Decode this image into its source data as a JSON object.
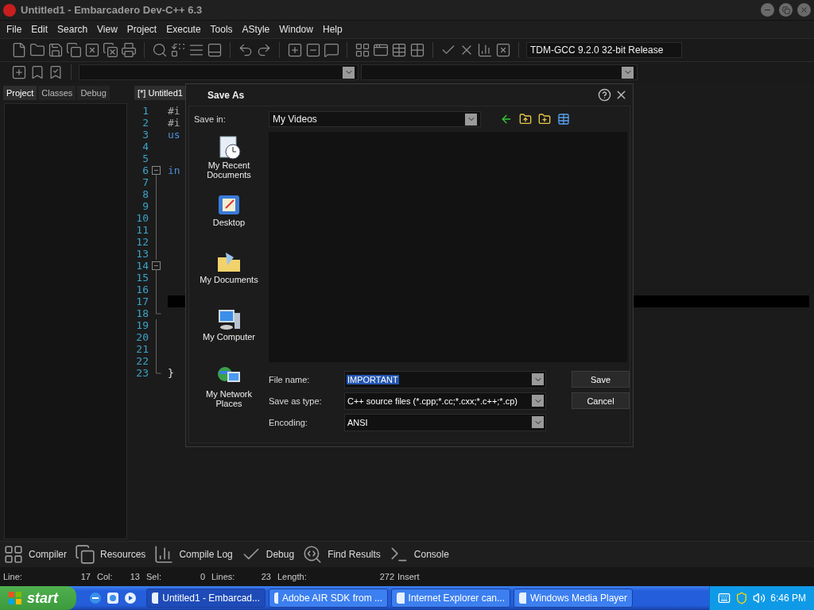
{
  "window": {
    "title": "Untitled1 - Embarcadero Dev-C++ 6.3"
  },
  "menu": [
    "File",
    "Edit",
    "Search",
    "View",
    "Project",
    "Execute",
    "Tools",
    "AStyle",
    "Window",
    "Help"
  ],
  "toolbar": {
    "compiler": "TDM-GCC 9.2.0 32-bit Release"
  },
  "left_panel": {
    "tabs": [
      {
        "label": "Project",
        "selected": true
      },
      {
        "label": "Classes",
        "selected": false
      },
      {
        "label": "Debug",
        "selected": false
      }
    ]
  },
  "editor": {
    "tabs": [
      {
        "label": "[*] Untitled1",
        "selected": true
      }
    ],
    "lines": [
      {
        "number": "1",
        "code": "#i",
        "kind": "directive",
        "current": false
      },
      {
        "number": "2",
        "code": "#i",
        "kind": "directive",
        "current": false
      },
      {
        "number": "3",
        "code": "us",
        "kind": "keyword",
        "current": false
      },
      {
        "number": "4",
        "current": false
      },
      {
        "number": "5",
        "current": false
      },
      {
        "number": "6",
        "code": "in",
        "kind": "keyword",
        "fold": {
          "kind": "open"
        },
        "current": false
      },
      {
        "number": "7",
        "fold": {
          "kind": "line"
        },
        "current": false
      },
      {
        "number": "8",
        "fold": {
          "kind": "line"
        },
        "current": false
      },
      {
        "number": "9",
        "fold": {
          "kind": "line"
        },
        "current": false
      },
      {
        "number": "10",
        "fold": {
          "kind": "line"
        },
        "current": false
      },
      {
        "number": "11",
        "fold": {
          "kind": "line"
        },
        "current": false
      },
      {
        "number": "12",
        "fold": {
          "kind": "line"
        },
        "current": false
      },
      {
        "number": "13",
        "fold": {
          "kind": "line"
        },
        "current": false
      },
      {
        "number": "14",
        "fold": {
          "kind": "open"
        },
        "current": false
      },
      {
        "number": "15",
        "fold": {
          "kind": "line"
        },
        "current": false
      },
      {
        "number": "16",
        "fold": {
          "kind": "line"
        },
        "current": false
      },
      {
        "number": "17",
        "fold": {
          "kind": "line"
        },
        "current": true
      },
      {
        "number": "18",
        "fold": {
          "kind": "end"
        },
        "current": false
      },
      {
        "number": "19",
        "fold": {
          "kind": "line"
        },
        "current": false
      },
      {
        "number": "20",
        "fold": {
          "kind": "line"
        },
        "current": false
      },
      {
        "number": "21",
        "fold": {
          "kind": "line"
        },
        "current": false
      },
      {
        "number": "22",
        "fold": {
          "kind": "line"
        },
        "current": false
      },
      {
        "number": "23",
        "code": "}",
        "kind": "brace",
        "fold": {
          "kind": "end"
        },
        "current": false
      }
    ]
  },
  "dialog": {
    "title": "Save As",
    "save_in": {
      "label": "Save in:",
      "value": "My Videos"
    },
    "places": [
      "My Recent Documents",
      "Desktop",
      "My Documents",
      "My Computer",
      "My Network Places"
    ],
    "fields": [
      {
        "label": "File name:",
        "value": "IMPORTANT",
        "selected": true
      },
      {
        "label": "Save as type:",
        "value": "C++ source files (*.cpp;*.cc;*.cxx;*.c++;*.cp)",
        "selected": false
      },
      {
        "label": "Encoding:",
        "value": "ANSI",
        "selected": false
      }
    ],
    "buttons": [
      "Save",
      "Cancel"
    ]
  },
  "bottom_tabs": [
    "Compiler",
    "Resources",
    "Compile Log",
    "Debug",
    "Find Results",
    "Console"
  ],
  "status_bar": {
    "cells": [
      {
        "label": "Line:",
        "value": "17"
      },
      {
        "label": "Col:",
        "value": "13"
      },
      {
        "label": "Sel:",
        "value": "0"
      },
      {
        "label": "Lines:",
        "value": "23"
      },
      {
        "label": "Length:",
        "value": "272"
      }
    ],
    "mode": "Insert"
  },
  "taskbar": {
    "start": "start",
    "tasks": [
      {
        "label": "Untitled1 - Embarcad...",
        "selected": true
      },
      {
        "label": "Adobe AIR SDK from ...",
        "selected": false
      },
      {
        "label": "Internet Explorer can...",
        "selected": false
      },
      {
        "label": "Windows Media Player",
        "selected": false
      }
    ],
    "clock": "6:46 PM"
  }
}
